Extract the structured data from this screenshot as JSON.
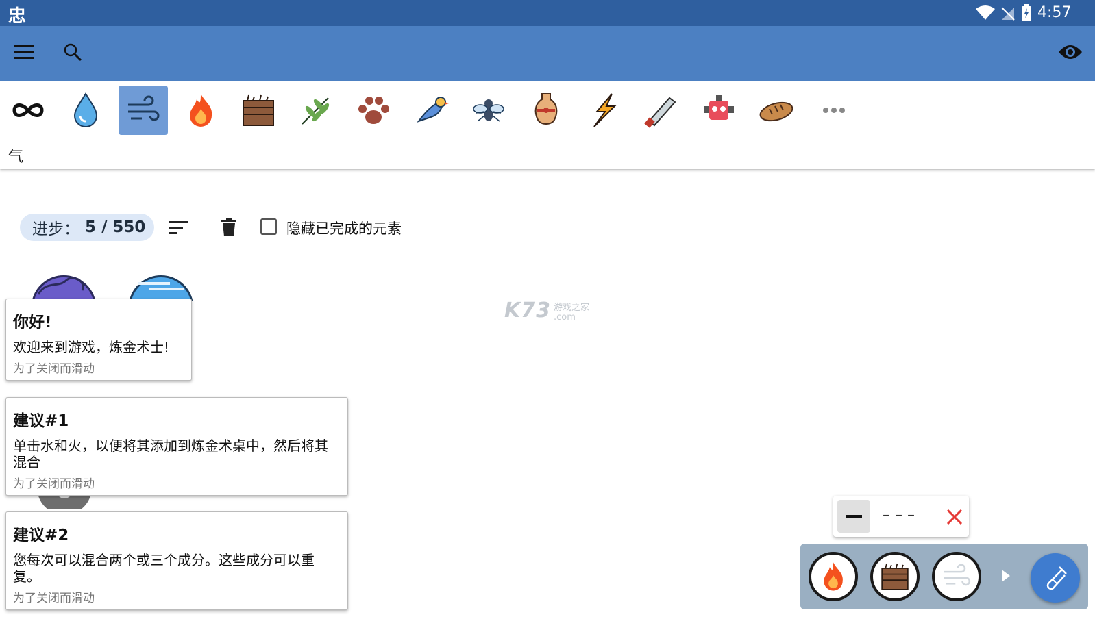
{
  "status": {
    "logo": "忠",
    "time": "4:57"
  },
  "appbar": {
    "menu_icon": "menu-icon",
    "search_icon": "search-icon",
    "visibility_icon": "eye-icon"
  },
  "categories": {
    "items": [
      {
        "icon": "infinity-icon"
      },
      {
        "icon": "water-drop-icon"
      },
      {
        "icon": "wind-icon",
        "selected": true
      },
      {
        "icon": "fire-icon"
      },
      {
        "icon": "earth-icon"
      },
      {
        "icon": "plant-icon"
      },
      {
        "icon": "paw-icon"
      },
      {
        "icon": "bird-icon"
      },
      {
        "icon": "fly-icon"
      },
      {
        "icon": "vase-icon"
      },
      {
        "icon": "lightning-icon"
      },
      {
        "icon": "saw-icon"
      },
      {
        "icon": "robot-icon"
      },
      {
        "icon": "bread-icon"
      },
      {
        "icon": "more-icon"
      }
    ],
    "selected_label": "气"
  },
  "toolbar": {
    "progress_label": "进步：",
    "progress_value": "5 / 550",
    "hide_completed_label": "隐藏已完成的元素",
    "hide_completed_checked": false
  },
  "watermark": {
    "text": "K73",
    "sub": "游戏之家",
    "domain": ".com"
  },
  "cards": [
    {
      "title": "你好!",
      "body": "欢迎来到游戏，炼金术士!",
      "hint": "为了关闭而滑动"
    },
    {
      "title": "建议#1",
      "body": "单击水和火，以便将其添加到炼金术桌中，然后将其混合",
      "hint": "为了关闭而滑动"
    },
    {
      "title": "建议#2",
      "body": "您每次可以混合两个或三个成分。这些成分可以重复。",
      "hint": "为了关闭而滑动"
    }
  ],
  "mix_panel": {
    "dashes": "– – –",
    "slots": [
      {
        "icon": "fire-icon"
      },
      {
        "icon": "earth-icon"
      },
      {
        "icon": "wind-icon"
      }
    ],
    "colors": {
      "panel": "#9aafc2",
      "fab": "#3f7ccf",
      "close": "#e53935"
    }
  }
}
